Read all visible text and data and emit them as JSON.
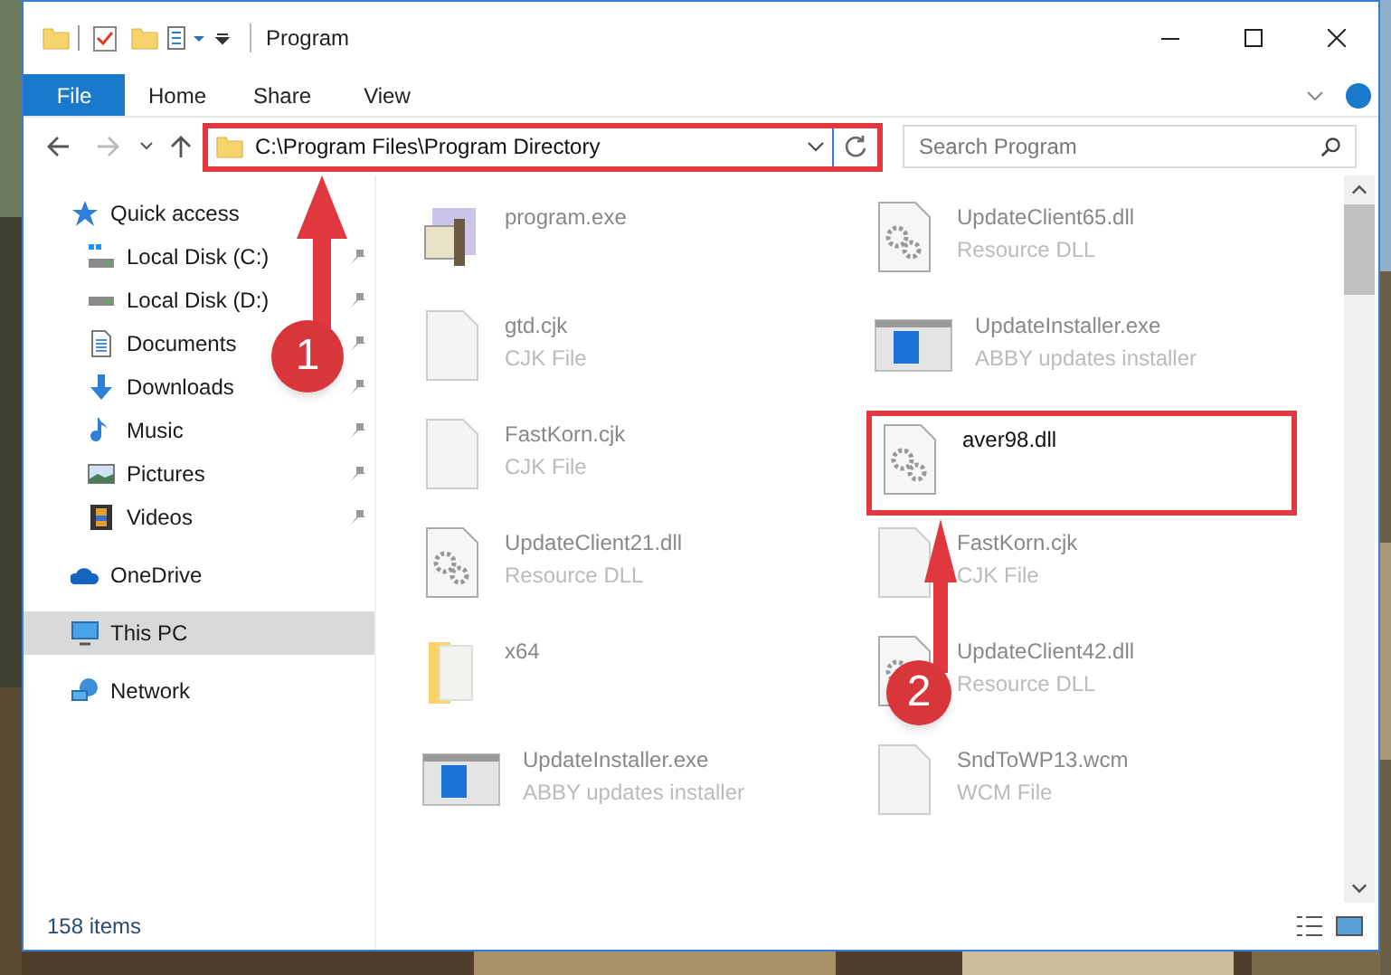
{
  "window": {
    "title": "Program"
  },
  "ribbon_tabs": [
    {
      "label": "File",
      "selected": true
    },
    {
      "label": "Home",
      "selected": false
    },
    {
      "label": "Share",
      "selected": false
    },
    {
      "label": "View",
      "selected": false
    }
  ],
  "address": {
    "path": "C:\\Program Files\\Program Directory",
    "highlighted": true
  },
  "search": {
    "placeholder": "Search Program"
  },
  "sidebar": {
    "items": [
      {
        "label": "Quick access",
        "kind": "star",
        "selected": false,
        "children": [
          {
            "label": "Local Disk (C:)",
            "kind": "windisk",
            "pinned": true,
            "selected": false
          },
          {
            "label": "Local Disk (D:)",
            "kind": "disk",
            "pinned": true,
            "selected": false
          },
          {
            "label": "Documents",
            "kind": "doc",
            "pinned": true,
            "selected": false
          },
          {
            "label": "Downloads",
            "kind": "download",
            "pinned": true,
            "selected": false
          },
          {
            "label": "Music",
            "kind": "music",
            "pinned": true,
            "selected": false
          },
          {
            "label": "Pictures",
            "kind": "pictures",
            "pinned": true,
            "selected": false
          },
          {
            "label": "Videos",
            "kind": "videos",
            "pinned": true,
            "selected": false
          }
        ]
      },
      {
        "label": "OneDrive",
        "kind": "cloud",
        "selected": false
      },
      {
        "label": "This PC",
        "kind": "pc",
        "selected": true
      },
      {
        "label": "Network",
        "kind": "network",
        "selected": false
      }
    ]
  },
  "files": [
    {
      "name": "program.exe",
      "kind": "app",
      "highlighted": false
    },
    {
      "name": "UpdateClient65.dll",
      "type": "Resource DLL",
      "kind": "dll",
      "highlighted": false
    },
    {
      "name": "gtd.cjk",
      "type": "CJK File",
      "kind": "blank",
      "highlighted": false
    },
    {
      "name": "UpdateInstaller.exe",
      "type": "ABBY updates installer",
      "kind": "installer",
      "highlighted": false
    },
    {
      "name": "FastKorn.cjk",
      "type": "CJK File",
      "kind": "blank",
      "highlighted": false
    },
    {
      "name": "aver98.dll",
      "kind": "dll",
      "highlighted": true
    },
    {
      "name": "UpdateClient21.dll",
      "type": "Resource DLL",
      "kind": "dll",
      "highlighted": false
    },
    {
      "name": "FastKorn.cjk",
      "type": "CJK File",
      "kind": "blank",
      "highlighted": false
    },
    {
      "name": "x64",
      "kind": "folder",
      "highlighted": false
    },
    {
      "name": "UpdateClient42.dll",
      "type": "Resource DLL",
      "kind": "dll",
      "highlighted": false
    },
    {
      "name": "UpdateInstaller.exe",
      "type": "ABBY updates installer",
      "kind": "installer",
      "highlighted": false
    },
    {
      "name": "SndToWP13.wcm",
      "type": "WCM File",
      "kind": "blank",
      "highlighted": false
    }
  ],
  "status_bar": {
    "count": "158 items"
  },
  "annotations": [
    {
      "label": "1"
    },
    {
      "label": "2"
    }
  ]
}
